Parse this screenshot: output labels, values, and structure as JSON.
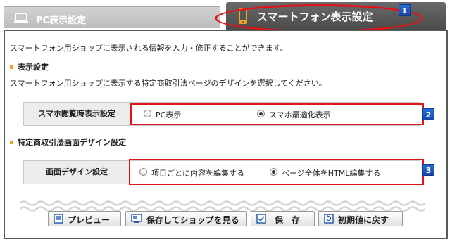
{
  "tabs": {
    "pc_label": "PC表示設定",
    "sp_label": "スマートフォン表示設定"
  },
  "badges": [
    "1",
    "2",
    "3"
  ],
  "intro": "スマートフォン用ショップに表示される情報を入力・修正することができます。",
  "display_section": {
    "title": "表示設定",
    "description": "スマートフォン用ショップに表示する特定商取引法ページのデザインを選択してください。",
    "row_label": "スマホ閲覧時表示設定",
    "options": [
      "PC表示",
      "スマホ最適化表示"
    ],
    "selected": "スマホ最適化表示"
  },
  "design_section": {
    "title": "特定商取引法画面デザイン設定",
    "row_label": "画面デザイン設定",
    "options": [
      "項目ごとに内容を編集する",
      "ページ全体をHTML編集する"
    ],
    "selected": "ページ全体をHTML編集する"
  },
  "buttons": {
    "preview": "プレビュー",
    "save_view": "保存してショップを見る",
    "save": "保　存",
    "reset": "初期値に戻す"
  },
  "colors": {
    "highlight": "#e0141b",
    "badge": "#1a56c0",
    "section_marker": "#f0a020",
    "active_tab": "#555555"
  }
}
